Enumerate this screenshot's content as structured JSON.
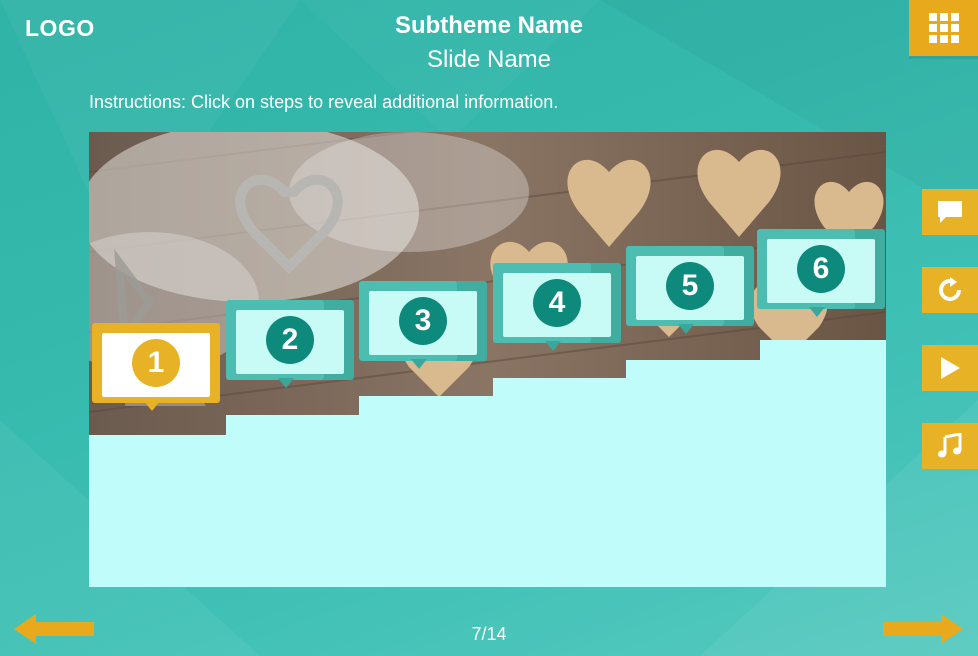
{
  "header": {
    "logo": "LOGO",
    "subtheme": "Subtheme Name",
    "slide_name": "Slide Name",
    "instructions": "Instructions: Click on steps to reveal additional information."
  },
  "menu_icon": "grid-menu-icon",
  "side_buttons": [
    "chat-icon",
    "replay-icon",
    "play-icon",
    "music-icon"
  ],
  "steps": [
    {
      "label": "1",
      "state": "active"
    },
    {
      "label": "2",
      "state": "inactive"
    },
    {
      "label": "3",
      "state": "inactive"
    },
    {
      "label": "4",
      "state": "inactive"
    },
    {
      "label": "5",
      "state": "inactive"
    },
    {
      "label": "6",
      "state": "inactive"
    }
  ],
  "footer": {
    "page": "7/14",
    "prev_icon": "arrow-left-icon",
    "next_icon": "arrow-right-icon"
  },
  "colors": {
    "background": "#35b9ad",
    "accent": "#e8b226",
    "step_teal": "#4dbdb1",
    "step_number": "#0e8a7d",
    "stage": "#c0fdfa"
  }
}
